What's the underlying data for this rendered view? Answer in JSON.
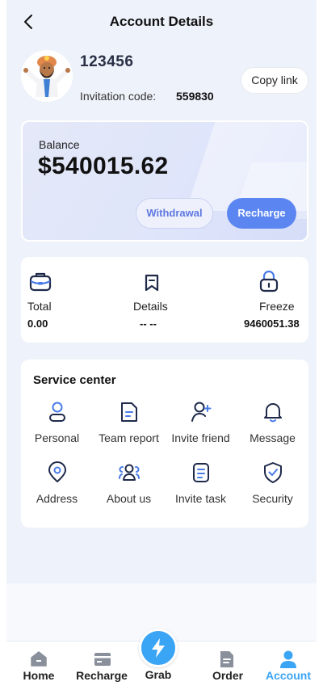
{
  "header": {
    "title": "Account Details"
  },
  "profile": {
    "user_id": "123456",
    "invitation_label": "Invitation code:",
    "invitation_code": "559830",
    "copy_label": "Copy link"
  },
  "balance": {
    "label": "Balance",
    "value": "$540015.62",
    "withdraw_label": "Withdrawal",
    "recharge_label": "Recharge"
  },
  "stats": [
    {
      "label": "Total",
      "value": "0.00",
      "icon": "briefcase-icon"
    },
    {
      "label": "Details",
      "value": "-- --",
      "icon": "bookmark-icon"
    },
    {
      "label": "Freeze",
      "value": "9460051.38",
      "icon": "lock-icon"
    }
  ],
  "service": {
    "title": "Service center",
    "items": [
      {
        "label": "Personal",
        "icon": "user-icon"
      },
      {
        "label": "Team report",
        "icon": "document-icon"
      },
      {
        "label": "Invite friend",
        "icon": "add-user-icon"
      },
      {
        "label": "Message",
        "icon": "bell-icon"
      },
      {
        "label": "Address",
        "icon": "location-icon"
      },
      {
        "label": "About us",
        "icon": "group-icon"
      },
      {
        "label": "Invite task",
        "icon": "task-icon"
      },
      {
        "label": "Security",
        "icon": "shield-icon"
      }
    ]
  },
  "nav": {
    "items": [
      {
        "label": "Home",
        "icon": "home-icon",
        "active": false
      },
      {
        "label": "Recharge",
        "icon": "wallet-icon",
        "active": false
      },
      {
        "label": "Grab",
        "icon": "lightning-icon",
        "active": false
      },
      {
        "label": "Order",
        "icon": "order-icon",
        "active": false
      },
      {
        "label": "Account",
        "icon": "account-icon",
        "active": true
      }
    ]
  },
  "colors": {
    "accent": "#5b86f2",
    "nav_active": "#3aa4f5",
    "icon_dark": "#1f2a4a",
    "icon_blue": "#4a7be8"
  }
}
